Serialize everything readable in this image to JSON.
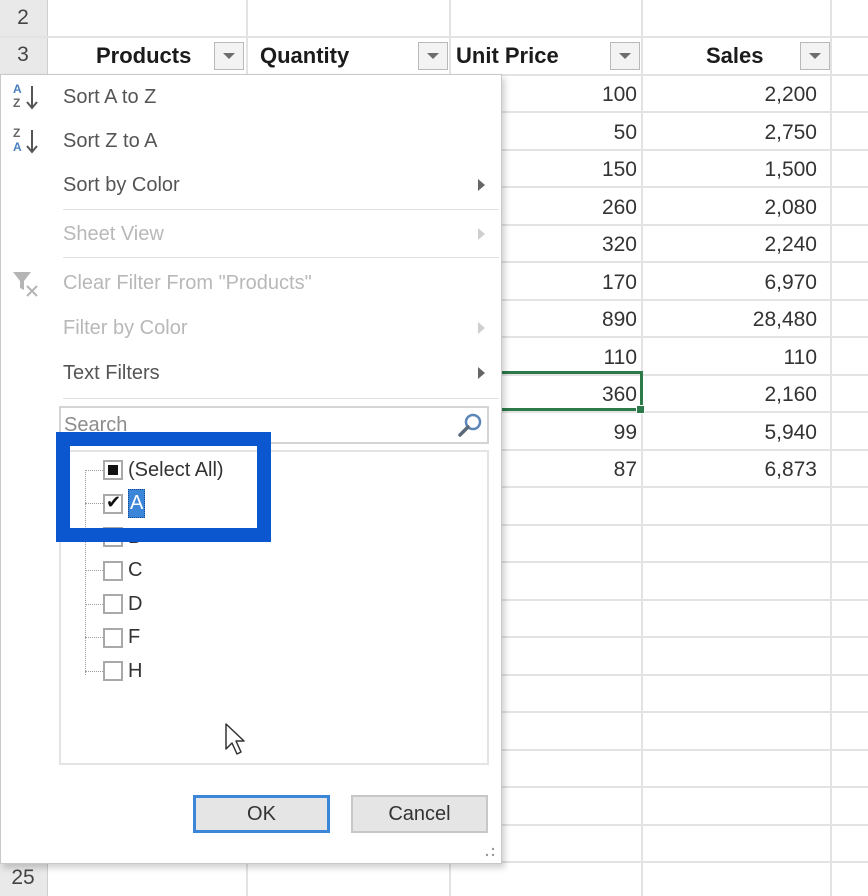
{
  "sheet": {
    "row_numbers": {
      "top_1": "2",
      "top_2": "3",
      "bottom": "25"
    },
    "headers": [
      {
        "label": "Products"
      },
      {
        "label": "Quantity"
      },
      {
        "label": "Unit Price"
      },
      {
        "label": "Sales"
      }
    ],
    "unit_price": [
      "100",
      "50",
      "150",
      "260",
      "320",
      "170",
      "890",
      "110",
      "360",
      "99",
      "87"
    ],
    "sales": [
      "2,200",
      "2,750",
      "1,500",
      "2,080",
      "2,240",
      "6,970",
      "28,480",
      "110",
      "2,160",
      "5,940",
      "6,873"
    ],
    "selected_cell_value": "360",
    "selection_color": "#2c7a4a"
  },
  "filter_menu": {
    "items": [
      {
        "label": "Sort A to Z",
        "icon": "sort-ascending-icon",
        "enabled": true,
        "submenu": false
      },
      {
        "label": "Sort Z to A",
        "icon": "sort-descending-icon",
        "enabled": true,
        "submenu": false
      },
      {
        "label": "Sort by Color",
        "enabled": true,
        "submenu": true
      },
      {
        "label": "Sheet View",
        "enabled": false,
        "submenu": true
      },
      {
        "label": "Clear Filter From \"Products\"",
        "icon": "clear-filter-icon",
        "enabled": false,
        "submenu": false
      },
      {
        "label": "Filter by Color",
        "enabled": false,
        "submenu": true
      },
      {
        "label": "Text Filters",
        "enabled": true,
        "submenu": true
      }
    ],
    "search": {
      "placeholder": "Search",
      "value": ""
    },
    "values": [
      {
        "label": "(Select All)",
        "state": "indeterminate"
      },
      {
        "label": "A",
        "state": "checked",
        "focused": true
      },
      {
        "label": "B",
        "state": "unchecked"
      },
      {
        "label": "C",
        "state": "unchecked"
      },
      {
        "label": "D",
        "state": "unchecked"
      },
      {
        "label": "F",
        "state": "unchecked"
      },
      {
        "label": "H",
        "state": "unchecked"
      }
    ],
    "ok_label": "OK",
    "cancel_label": "Cancel",
    "highlight_color": "#0a57d0"
  }
}
